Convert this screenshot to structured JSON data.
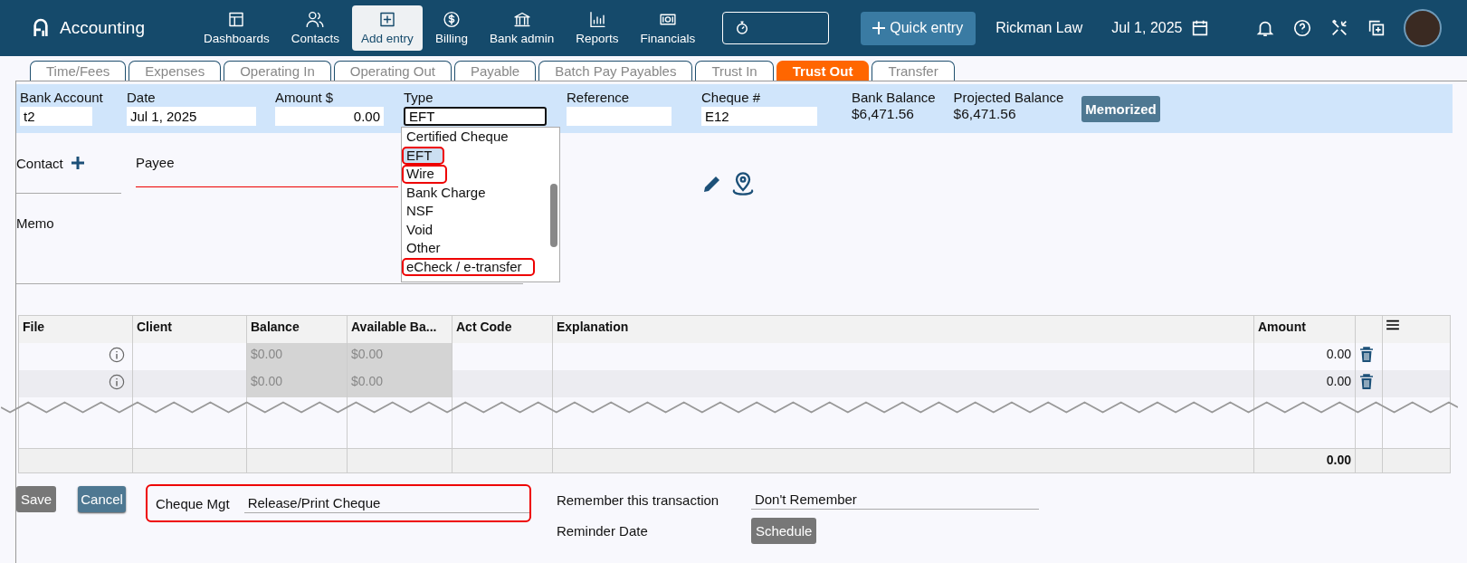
{
  "app": {
    "title": "Accounting"
  },
  "nav": [
    {
      "label": "Dashboards",
      "selected": false
    },
    {
      "label": "Contacts",
      "selected": false
    },
    {
      "label": "Add entry",
      "selected": true
    },
    {
      "label": "Billing",
      "selected": false
    },
    {
      "label": "Bank admin",
      "selected": false
    },
    {
      "label": "Reports",
      "selected": false
    },
    {
      "label": "Financials",
      "selected": false
    }
  ],
  "quick_entry": "Quick entry",
  "firm": "Rickman Law",
  "date": "Jul 1, 2025",
  "tabs": [
    {
      "label": "Time/Fees",
      "selected": false
    },
    {
      "label": "Expenses",
      "selected": false
    },
    {
      "label": "Operating In",
      "selected": false
    },
    {
      "label": "Operating Out",
      "selected": false
    },
    {
      "label": "Payable",
      "selected": false
    },
    {
      "label": "Batch Pay Payables",
      "selected": false
    },
    {
      "label": "Trust In",
      "selected": false
    },
    {
      "label": "Trust Out",
      "selected": true
    },
    {
      "label": "Transfer",
      "selected": false
    }
  ],
  "fields": [
    {
      "label": "Bank Account",
      "value": "t2"
    },
    {
      "label": "Date",
      "value": "Jul 1, 2025"
    },
    {
      "label": "Amount $",
      "value": "0.00"
    },
    {
      "label": "Type",
      "value": "EFT"
    },
    {
      "label": "Reference"
    },
    {
      "label": "Cheque #",
      "value": "E12"
    }
  ],
  "balances": [
    {
      "label": "Bank Balance",
      "value": "$6,471.56"
    },
    {
      "label": "Projected Balance",
      "value": "$6,471.56"
    }
  ],
  "memorized": "Memorized",
  "type_options": [
    {
      "label": "Certified Cheque",
      "selected": false,
      "highlighted": false
    },
    {
      "label": "EFT",
      "selected": true,
      "highlighted": true
    },
    {
      "label": "Wire",
      "selected": false,
      "highlighted": true
    },
    {
      "label": "Bank Charge",
      "selected": false,
      "highlighted": false
    },
    {
      "label": "NSF",
      "selected": false,
      "highlighted": false
    },
    {
      "label": "Void",
      "selected": false,
      "highlighted": false
    },
    {
      "label": "Other",
      "selected": false,
      "highlighted": false
    },
    {
      "label": "eCheck / e-transfer",
      "selected": false,
      "highlighted": true
    }
  ],
  "contact_label": "Contact",
  "payee_label": "Payee",
  "memo_label": "Memo",
  "table": {
    "columns": [
      "File",
      "Client",
      "Balance",
      "Available Ba...",
      "Act Code",
      "Explanation",
      "Amount"
    ],
    "rows": [
      {
        "balance": "$0.00",
        "available": "$0.00",
        "amount": "0.00"
      },
      {
        "balance": "$0.00",
        "available": "$0.00",
        "amount": "0.00"
      }
    ],
    "total": "0.00"
  },
  "buttons": {
    "save": "Save",
    "cancel": "Cancel",
    "schedule": "Schedule"
  },
  "cheque_mgt": {
    "label": "Cheque Mgt",
    "value": "Release/Print Cheque",
    "highlighted": true
  },
  "remember": {
    "label": "Remember this transaction",
    "value": "Don't Remember"
  },
  "reminder_label": "Reminder Date"
}
